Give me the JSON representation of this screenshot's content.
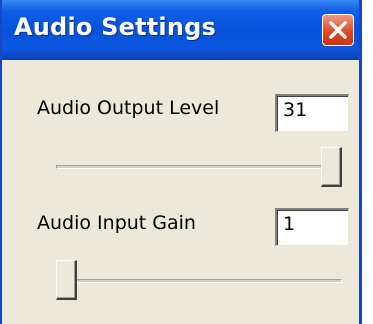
{
  "window": {
    "title": "Audio Settings"
  },
  "controls": {
    "output": {
      "label": "Audio Output Level",
      "value": "31",
      "slider_fraction": 1.0
    },
    "input": {
      "label": "Audio Input Gain",
      "value": "1",
      "slider_fraction": 0.0
    }
  },
  "icons": {
    "close": "close-icon"
  },
  "colors": {
    "titlebar": "#0752da",
    "close_button": "#dd4b28",
    "window_bg": "#ece9d8"
  }
}
